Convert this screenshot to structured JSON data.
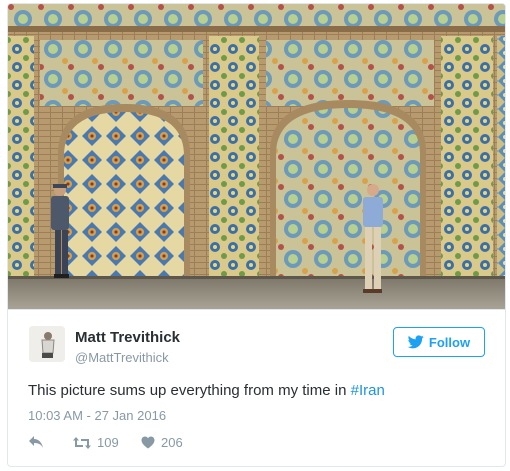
{
  "tweet": {
    "author": {
      "name": "Matt Trevithick",
      "handle": "@MattTrevithick"
    },
    "follow_label": "Follow",
    "text_before": "This picture sums up everything from my time in ",
    "hashtag": "#Iran",
    "timestamp": "10:03 AM - 27 Jan 2016",
    "retweet_count": "109",
    "like_count": "206"
  },
  "icons": {
    "follow": "twitter-bird-icon",
    "reply": "reply-icon",
    "retweet": "retweet-icon",
    "like": "heart-icon"
  },
  "colors": {
    "accent": "#1da1f2",
    "link": "#1b95e0",
    "text": "#292f33",
    "muted": "#8899a6",
    "border": "#e1e8ed"
  }
}
